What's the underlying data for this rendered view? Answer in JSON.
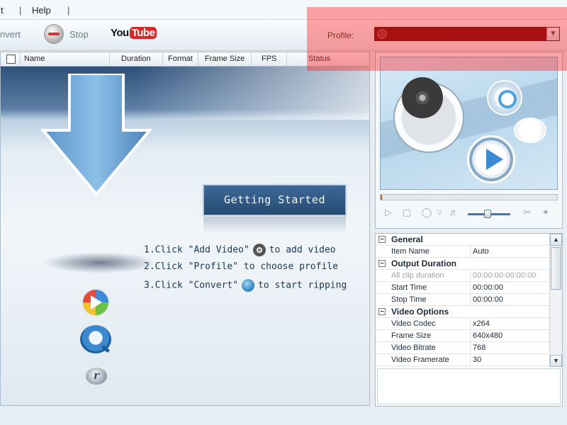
{
  "menu": {
    "items": [
      "t",
      "Help"
    ]
  },
  "toolbar": {
    "convert_label": "nvert",
    "stop_label": "Stop",
    "youtube_you": "You",
    "youtube_tube": "Tube",
    "profile_label": "Profile:",
    "profile_value": ""
  },
  "filelist": {
    "columns": [
      "Name",
      "Duration",
      "Format",
      "Frame Size",
      "FPS",
      "Status"
    ],
    "getting_started": "Getting Started",
    "steps": [
      {
        "pre": "1.Click \"Add Video\"",
        "post": "to add video",
        "icon": "film-reel-icon"
      },
      {
        "pre": "2.Click \"Profile\" to choose profile",
        "post": "",
        "icon": ""
      },
      {
        "pre": "3.Click \"Convert\"",
        "post": "to start ripping",
        "icon": "convert-icon"
      }
    ]
  },
  "preview": {
    "progress_fraction": 0.0
  },
  "properties": {
    "groups": [
      {
        "title": "General",
        "rows": [
          {
            "k": "Item Name",
            "v": "Auto",
            "disabled": false
          }
        ]
      },
      {
        "title": "Output Duration",
        "rows": [
          {
            "k": "All clip duration",
            "v": "00:00:00-00:00:00",
            "disabled": true
          },
          {
            "k": "Start Time",
            "v": "00:00:00",
            "disabled": false
          },
          {
            "k": "Stop Time",
            "v": "00:00:00",
            "disabled": false
          }
        ]
      },
      {
        "title": "Video Options",
        "rows": [
          {
            "k": "Video Codec",
            "v": "x264",
            "disabled": false
          },
          {
            "k": "Frame Size",
            "v": "640x480",
            "disabled": false
          },
          {
            "k": "Video Bitrate",
            "v": "768",
            "disabled": false
          },
          {
            "k": "Video Framerate",
            "v": "30",
            "disabled": false
          }
        ]
      }
    ]
  },
  "colors": {
    "highlight": "#ff2828",
    "profile_bg": "#6a0000",
    "accent": "#244a72"
  }
}
